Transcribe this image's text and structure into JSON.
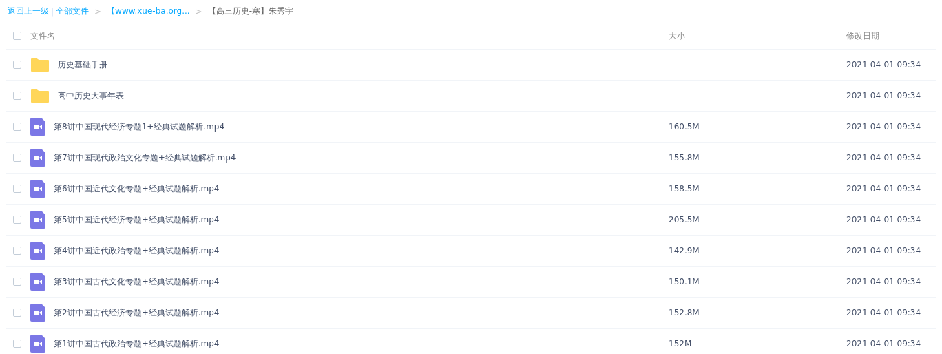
{
  "breadcrumb": [
    {
      "kind": "link",
      "text": "返回上一级"
    },
    {
      "kind": "divider",
      "text": "|"
    },
    {
      "kind": "link",
      "text": "全部文件"
    },
    {
      "kind": "arrow",
      "text": ">"
    },
    {
      "kind": "link",
      "text": "【www.xue-ba.org..."
    },
    {
      "kind": "arrow",
      "text": ">"
    },
    {
      "kind": "current",
      "text": "【高三历史-寒】朱秀宇"
    }
  ],
  "table": {
    "select_all": {
      "checked": false
    },
    "columns": [
      "文件名",
      "大小",
      "修改日期"
    ],
    "rows": [
      {
        "kind": "folder",
        "checked": false,
        "name": "历史基础手册",
        "size": "-",
        "modified": "2021-04-01 09:34"
      },
      {
        "kind": "folder",
        "checked": false,
        "name": "高中历史大事年表",
        "size": "-",
        "modified": "2021-04-01 09:34"
      },
      {
        "kind": "video",
        "checked": false,
        "name": "第8讲中国现代经济专题1+经典试题解析.mp4",
        "size": "160.5M",
        "modified": "2021-04-01 09:34"
      },
      {
        "kind": "video",
        "checked": false,
        "name": "第7讲中国现代政治文化专题+经典试题解析.mp4",
        "size": "155.8M",
        "modified": "2021-04-01 09:34"
      },
      {
        "kind": "video",
        "checked": false,
        "name": "第6讲中国近代文化专题+经典试题解析.mp4",
        "size": "158.5M",
        "modified": "2021-04-01 09:34"
      },
      {
        "kind": "video",
        "checked": false,
        "name": "第5讲中国近代经济专题+经典试题解析.mp4",
        "size": "205.5M",
        "modified": "2021-04-01 09:34"
      },
      {
        "kind": "video",
        "checked": false,
        "name": "第4讲中国近代政治专题+经典试题解析.mp4",
        "size": "142.9M",
        "modified": "2021-04-01 09:34"
      },
      {
        "kind": "video",
        "checked": false,
        "name": "第3讲中国古代文化专题+经典试题解析.mp4",
        "size": "150.1M",
        "modified": "2021-04-01 09:34"
      },
      {
        "kind": "video",
        "checked": false,
        "name": "第2讲中国古代经济专题+经典试题解析.mp4",
        "size": "152.8M",
        "modified": "2021-04-01 09:34"
      },
      {
        "kind": "video",
        "checked": false,
        "name": "第1讲中国古代政治专题+经典试题解析.mp4",
        "size": "152M",
        "modified": "2021-04-01 09:34"
      }
    ]
  }
}
